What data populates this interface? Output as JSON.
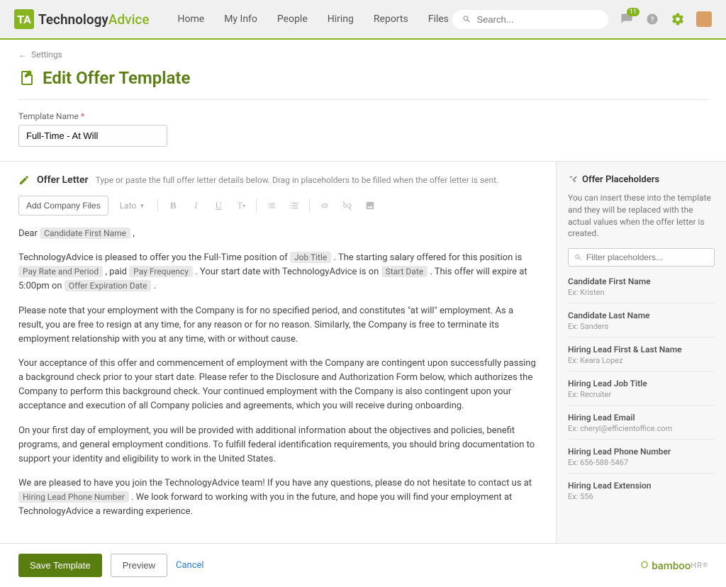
{
  "header": {
    "logo": {
      "mark": "TA",
      "bold": "Technology",
      "light": "Advice"
    },
    "nav": [
      "Home",
      "My Info",
      "People",
      "Hiring",
      "Reports",
      "Files"
    ],
    "search_placeholder": "Search...",
    "inbox_badge": "11"
  },
  "breadcrumb": {
    "back_arrow": "←",
    "link": "Settings"
  },
  "page": {
    "title": "Edit Offer Template"
  },
  "template_name": {
    "label": "Template Name",
    "required": "*",
    "value": "Full-Time - At Will"
  },
  "editor": {
    "heading": "Offer Letter",
    "subheading": "Type or paste the full offer letter details below. Drag in placeholders to be filled when the offer letter is sent.",
    "toolbar": {
      "add_files": "Add Company Files",
      "font": "Lato"
    },
    "body": {
      "greeting_prefix": "Dear ",
      "greeting_suffix": " ,",
      "token_candidate_first": "Candidate First Name",
      "p1_a": "TechnologyAdvice is pleased to offer you the Full-Time position of ",
      "token_job_title": "Job Title",
      "p1_b": " . The starting salary offered for this position is ",
      "token_pay_rate": "Pay Rate and Period",
      "p1_c": " , paid ",
      "token_pay_freq": "Pay Frequency",
      "p1_d": " . Your start date with TechnologyAdvice is on ",
      "token_start_date": "Start Date",
      "p1_e": " . This offer will expire at 5:00pm on ",
      "token_expiration": "Offer Expiration Date",
      "p1_f": " .",
      "p2": "Please note that your employment with the Company is for no specified period, and constitutes \"at will\" employment. As a result, you are free to resign at any time, for any reason or for no reason. Similarly, the Company is free to terminate its employment relationship with you at any time, with or without cause.",
      "p3": "Your acceptance of this offer and commencement of employment with the Company are contingent upon successfully passing a background check prior to your start date. Please refer to the Disclosure and Authorization Form below, which authorizes the Company to perform this background check. Your continued employment with the Company is also contingent upon your acceptance and execution of all Company policies and agreements, which you will receive during onboarding.",
      "p4": "On your first day of employment, you will be provided with additional information about the objectives and policies, benefit programs, and general employment conditions. To fulfill federal identification requirements, you should bring documentation to support your identity and eligibility to work in the United States.",
      "p5_a": "We are pleased to have you join the TechnologyAdvice team! If you have any questions, please do not hesitate to contact us at ",
      "token_hl_phone": "Hiring Lead Phone Number",
      "p5_b": " . We look forward to working with you in the future, and hope you will find your employment at TechnologyAdvice a rewarding experience."
    }
  },
  "sidebar": {
    "heading": "Offer Placeholders",
    "help": "You can insert these into the template and they will be replaced with the actual values when the offer letter is created.",
    "filter_placeholder": "Filter placeholders...",
    "items": [
      {
        "name": "Candidate First Name",
        "ex": "Ex: Kristen"
      },
      {
        "name": "Candidate Last Name",
        "ex": "Ex: Sanders"
      },
      {
        "name": "Hiring Lead First & Last Name",
        "ex": "Ex: Keara Lopez"
      },
      {
        "name": "Hiring Lead Job Title",
        "ex": "Ex: Recruiter"
      },
      {
        "name": "Hiring Lead Email",
        "ex": "Ex: cheryl@efficientoffice.com"
      },
      {
        "name": "Hiring Lead Phone Number",
        "ex": "Ex: 656-588-5467"
      },
      {
        "name": "Hiring Lead Extension",
        "ex": "Ex: 556"
      }
    ]
  },
  "footer": {
    "save": "Save Template",
    "preview": "Preview",
    "cancel": "Cancel",
    "brand_bold": "bamboo",
    "brand_light": "HR",
    "brand_reg": "®"
  }
}
